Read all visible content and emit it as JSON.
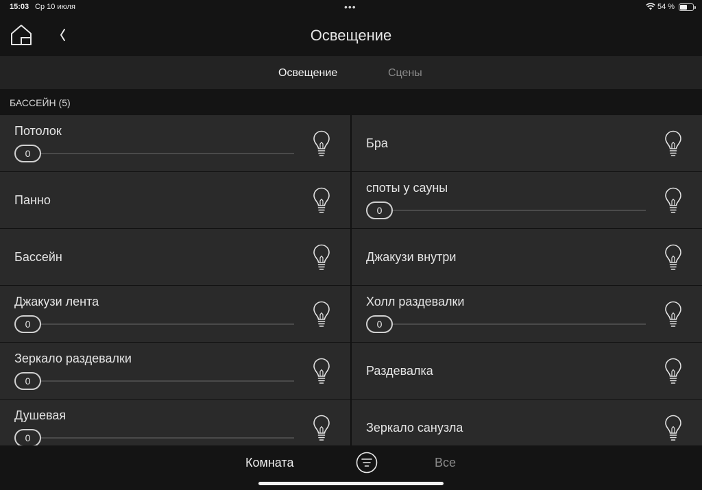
{
  "status_bar": {
    "time": "15:03",
    "date": "Ср 10 июля",
    "battery": "54 %",
    "battery_level": 0.54
  },
  "header": {
    "title": "Освещение",
    "home_icon": "home-icon",
    "back_icon": "chevron-left-icon"
  },
  "tabs": [
    {
      "label": "Освещение",
      "active": true
    },
    {
      "label": "Сцены",
      "active": false
    }
  ],
  "section": {
    "title": "БАССЕЙН (5)"
  },
  "lights": [
    {
      "name": "Потолок",
      "dimmer": true,
      "value": "0"
    },
    {
      "name": "Бра",
      "dimmer": false
    },
    {
      "name": "Панно",
      "dimmer": false
    },
    {
      "name": "споты у сауны",
      "dimmer": true,
      "value": "0"
    },
    {
      "name": "Бассейн",
      "dimmer": false
    },
    {
      "name": "Джакузи внутри",
      "dimmer": false
    },
    {
      "name": "Джакузи лента",
      "dimmer": true,
      "value": "0"
    },
    {
      "name": "Холл раздевалки",
      "dimmer": true,
      "value": "0"
    },
    {
      "name": "Зеркало раздевалки",
      "dimmer": true,
      "value": "0"
    },
    {
      "name": "Раздевалка",
      "dimmer": false
    },
    {
      "name": "Душевая",
      "dimmer": true,
      "value": "0"
    },
    {
      "name": "Зеркало санузла",
      "dimmer": false
    }
  ],
  "bottom_bar": {
    "room_label": "Комната",
    "all_label": "Все",
    "filter_icon": "filter-icon"
  },
  "colors": {
    "background": "#121212",
    "cell": "#2a2a2a",
    "text": "#e4e4e4",
    "inactive_text": "#8a8a8a"
  }
}
